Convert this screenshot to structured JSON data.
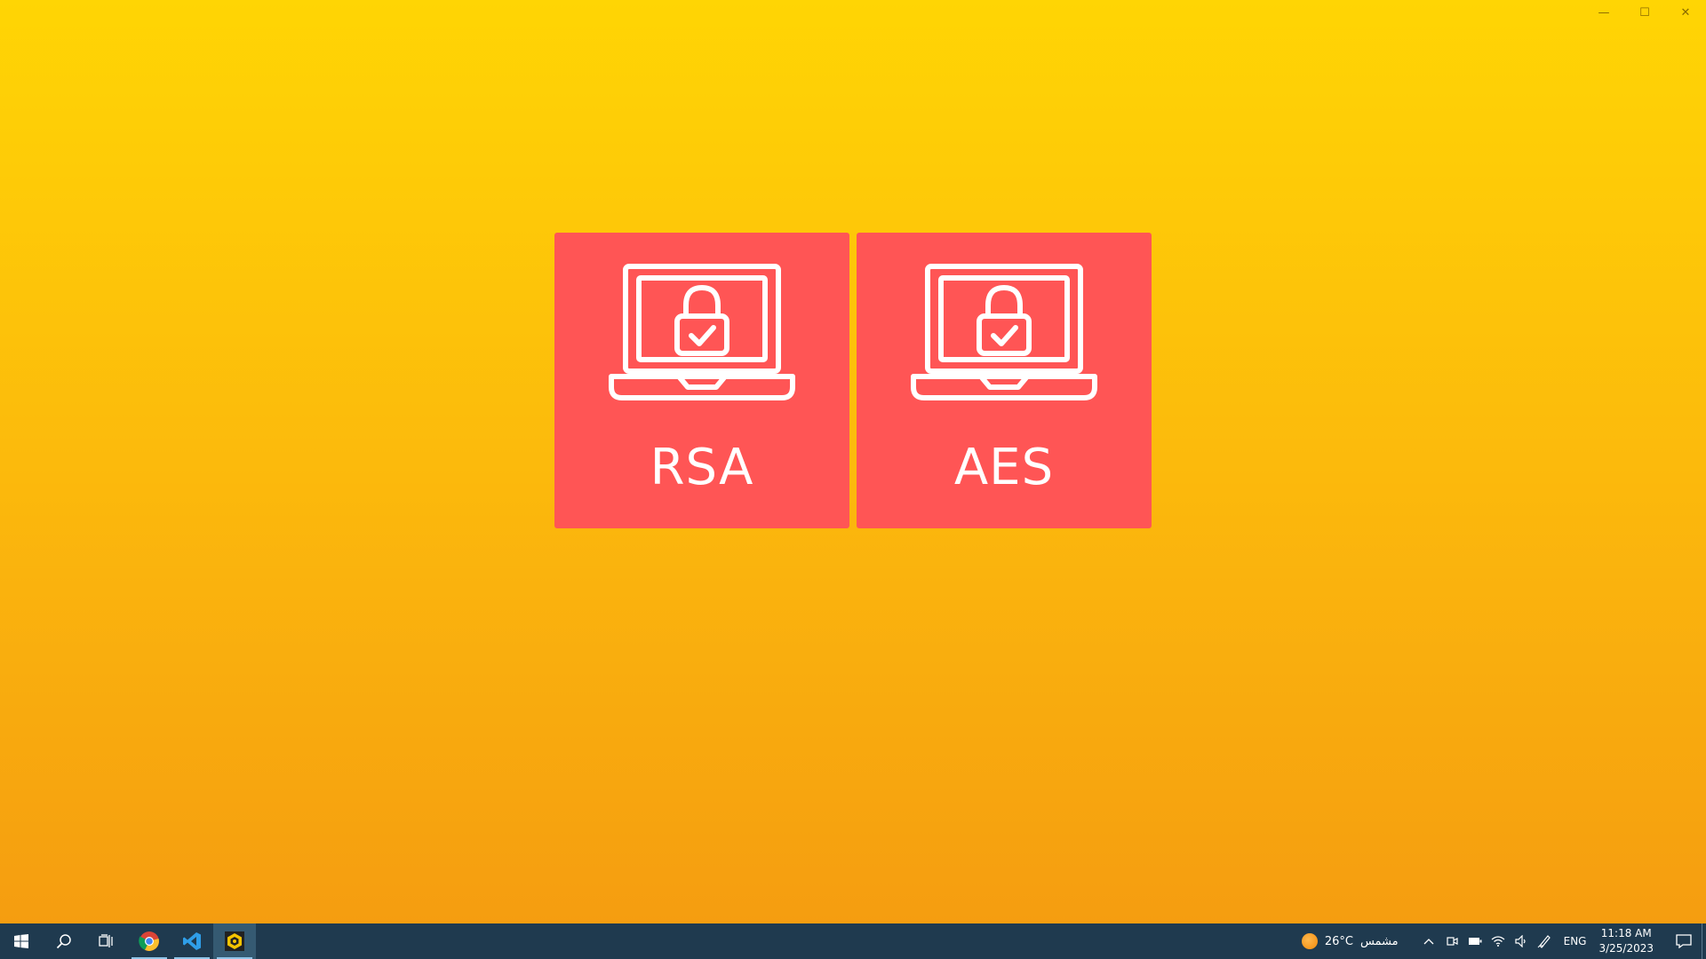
{
  "window": {
    "minimize_glyph": "—",
    "maximize_glyph": "☐",
    "close_glyph": "✕"
  },
  "tiles": [
    {
      "label": "RSA",
      "icon": "laptop-lock-icon"
    },
    {
      "label": "AES",
      "icon": "laptop-lock-icon"
    }
  ],
  "colors": {
    "background_top": "#FFD504",
    "background_bottom": "#F59D10",
    "tile": "#FF5555",
    "taskbar": "#1f3a4f"
  },
  "taskbar": {
    "apps": [
      "windows-start-icon",
      "search-icon",
      "task-view-icon",
      "chrome-icon",
      "vscode-icon",
      "app-hex-icon"
    ],
    "weather": {
      "temp": "26°C",
      "condition": "مشمس"
    },
    "language": "ENG",
    "time": "11:18 AM",
    "date": "3/25/2023"
  }
}
